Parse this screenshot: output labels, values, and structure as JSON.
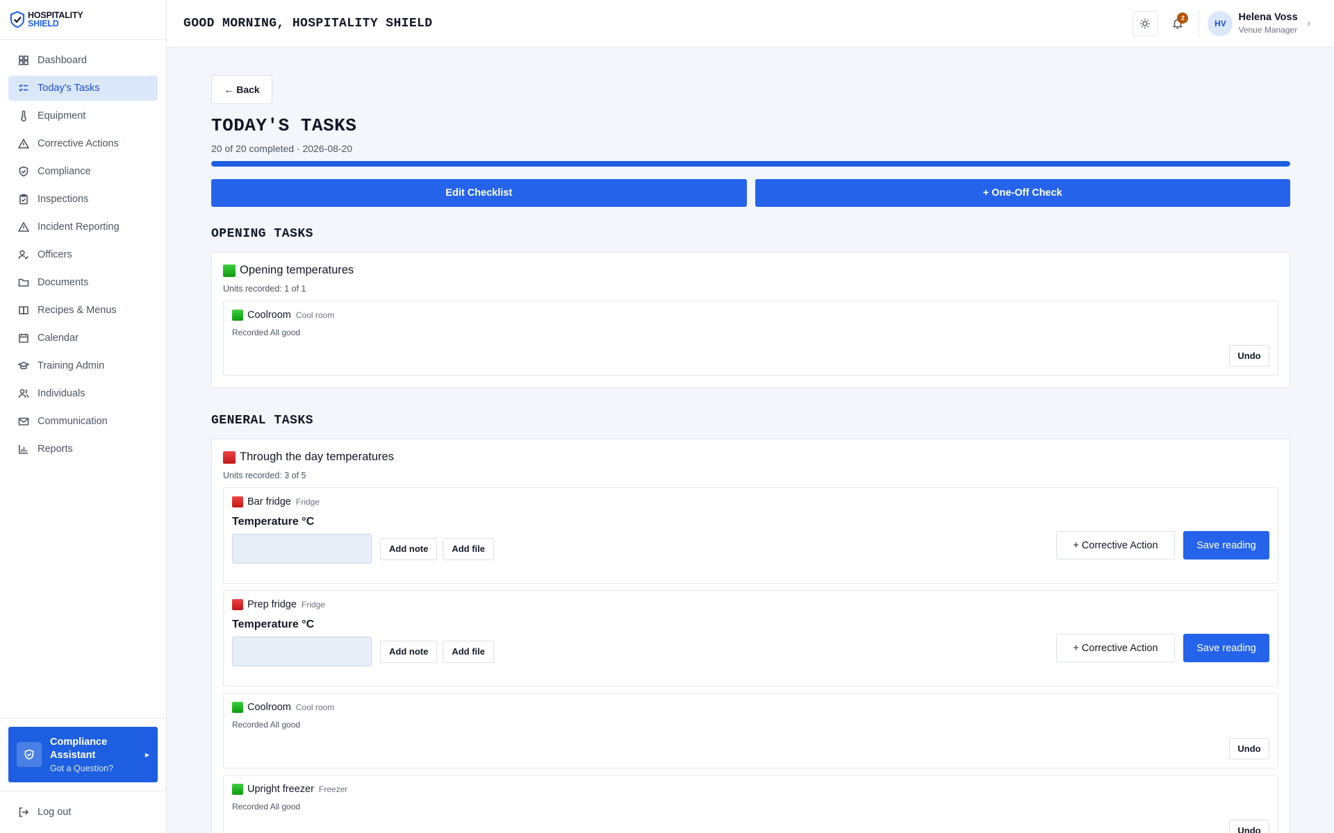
{
  "brand": {
    "line1": "HOSPITALITY",
    "line2": "SHIELD",
    "accent": "#2563eb"
  },
  "sidebar": {
    "items": [
      {
        "label": "Dashboard",
        "icon": "grid-icon"
      },
      {
        "label": "Today's Tasks",
        "icon": "checklist-icon",
        "active": true
      },
      {
        "label": "Equipment",
        "icon": "thermometer-icon"
      },
      {
        "label": "Corrective Actions",
        "icon": "warning-icon"
      },
      {
        "label": "Compliance",
        "icon": "shield-check-icon"
      },
      {
        "label": "Inspections",
        "icon": "clipboard-icon"
      },
      {
        "label": "Incident Reporting",
        "icon": "alert-triangle-icon"
      },
      {
        "label": "Officers",
        "icon": "user-check-icon"
      },
      {
        "label": "Documents",
        "icon": "folder-icon"
      },
      {
        "label": "Recipes & Menus",
        "icon": "book-icon"
      },
      {
        "label": "Calendar",
        "icon": "calendar-icon"
      },
      {
        "label": "Training Admin",
        "icon": "graduation-cap-icon"
      },
      {
        "label": "Individuals",
        "icon": "users-icon"
      },
      {
        "label": "Communication",
        "icon": "mail-icon"
      },
      {
        "label": "Reports",
        "icon": "bar-chart-icon"
      }
    ],
    "assistant": {
      "title": "Compliance Assistant",
      "subtitle": "Got a Question?"
    },
    "logout": "Log out"
  },
  "topbar": {
    "greeting": "GOOD MORNING, HOSPITALITY SHIELD",
    "notifications": "2",
    "user": {
      "initials": "HV",
      "name": "Helena Voss",
      "role": "Venue Manager"
    }
  },
  "main": {
    "back": "Back",
    "title": "TODAY'S TASKS",
    "subtitle": "20 of 20 completed · 2026-08-20",
    "progress": 1.0,
    "edit_checklist": "Edit Checklist",
    "one_off": "+ One-Off Check",
    "opening": {
      "heading": "OPENING TASKS",
      "card_title": "Opening temperatures",
      "units_recorded": "Units recorded: 1 of 1",
      "status": "green",
      "units": [
        {
          "name": "Coolroom",
          "type": "Cool room",
          "recorded": "Recorded All good",
          "undo": "Undo"
        }
      ]
    },
    "general": {
      "heading": "GENERAL TASKS",
      "card_title": "Through the day temperatures",
      "units_recorded": "Units recorded: 3 of 5",
      "status": "red",
      "pending_units": [
        {
          "name": "Bar fridge",
          "type": "Fridge",
          "temp_label": "Temperature °C",
          "add_note": "Add note",
          "add_file": "Add file",
          "corrective": "+ Corrective Action",
          "save": "Save reading"
        },
        {
          "name": "Prep fridge",
          "type": "Fridge",
          "temp_label": "Temperature °C",
          "add_note": "Add note",
          "add_file": "Add file",
          "corrective": "+ Corrective Action",
          "save": "Save reading"
        }
      ],
      "done_units": [
        {
          "name": "Coolroom",
          "type": "Cool room",
          "recorded": "Recorded All good",
          "undo": "Undo"
        },
        {
          "name": "Upright freezer",
          "type": "Freezer",
          "recorded": "Recorded All good",
          "undo": "Undo"
        }
      ]
    }
  }
}
